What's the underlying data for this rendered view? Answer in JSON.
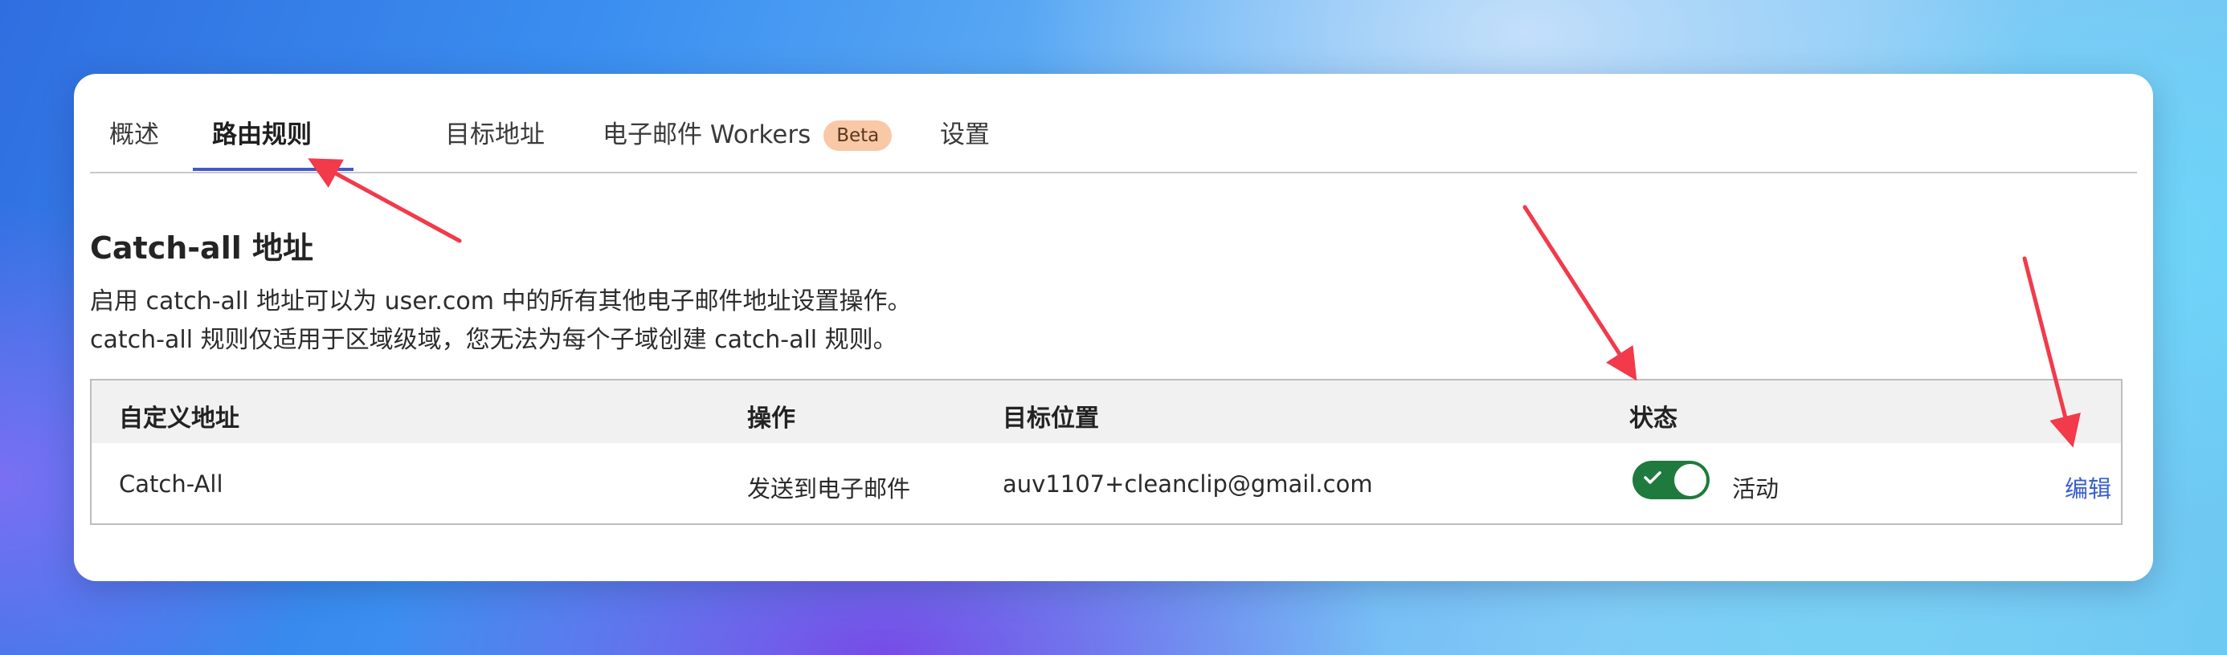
{
  "tabs": [
    {
      "label": "概述"
    },
    {
      "label": "路由规则"
    },
    {
      "label": "目标地址"
    },
    {
      "label": "电子邮件 Workers",
      "badge": "Beta"
    },
    {
      "label": "设置"
    }
  ],
  "active_tab": "路由规则",
  "section": {
    "title": "Catch-all 地址",
    "desc_line1": "启用 catch-all 地址可以为 user.com 中的所有其他电子邮件地址设置操作。",
    "desc_line2": "catch-all 规则仅适用于区域级域，您无法为每个子域创建 catch-all 规则。"
  },
  "table": {
    "headers": [
      "自定义地址",
      "操作",
      "目标位置",
      "状态"
    ],
    "rows": [
      {
        "address": "Catch-All",
        "action": "发送到电子邮件",
        "destination": "auv1107+cleanclip@gmail.com",
        "status_label": "活动",
        "enabled": true,
        "edit_label": "编辑"
      }
    ]
  },
  "colors": {
    "accent_underline": "#4459c8",
    "toggle_on": "#1f7a3d",
    "link": "#3a5fcd",
    "badge_bg": "#f9c8a6",
    "annotation_arrow": "#f23a4a"
  }
}
